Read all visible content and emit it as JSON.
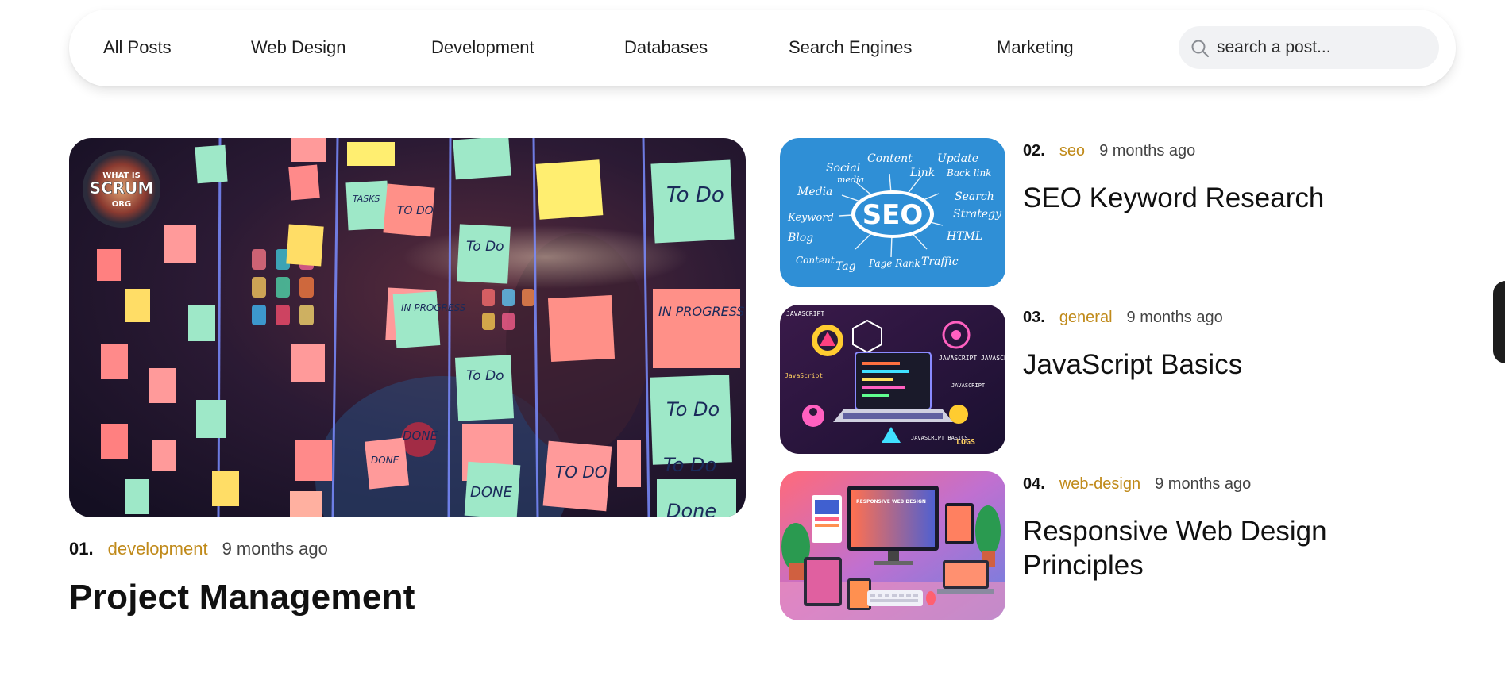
{
  "nav": {
    "links": [
      "All Posts",
      "Web Design",
      "Development",
      "Databases",
      "Search Engines",
      "Marketing"
    ],
    "divider": "|",
    "search": {
      "placeholder": "search a post...",
      "value": ""
    }
  },
  "featured": {
    "number": "01.",
    "category": "development",
    "time": "9 months ago",
    "title": "Project Management",
    "badge_text": [
      "WHAT IS",
      "SCRUM",
      "ORG"
    ],
    "notes": [
      "TASKS",
      "TO DO",
      "To Do",
      "IN PROGRESS",
      "To Do",
      "IN PROGRESS",
      "To Do",
      "DONE",
      "DONE",
      "TO DO",
      "DONE",
      "To Do",
      "To Do",
      "Done"
    ]
  },
  "posts": [
    {
      "number": "02.",
      "category": "seo",
      "time": "9 months ago",
      "title": "SEO Keyword Research",
      "image_words": [
        "SEO",
        "Social",
        "media",
        "Content",
        "Link",
        "Update",
        "Back link",
        "Search",
        "Strategy",
        "HTML",
        "Traffic",
        "Page Rank",
        "Tag",
        "Blog",
        "Keyword",
        "Media",
        "Content"
      ]
    },
    {
      "number": "03.",
      "category": "general",
      "time": "9 months ago",
      "title": "JavaScript Basics",
      "image_words": [
        "JAVASCRIPT",
        "JAVASCRIPT JAVASCPT",
        "JAVASCRIPT",
        "JavaScript",
        "JAVASCRIPT BASICS",
        "LOGS"
      ]
    },
    {
      "number": "04.",
      "category": "web-design",
      "time": "9 months ago",
      "title": "Responsive Web Design Principles",
      "image_words": [
        "RESPONSIVE WEB DESIGN"
      ]
    }
  ],
  "colors": {
    "category": "#c08a1a",
    "seo_bg": "#2f8fd6",
    "search_bg": "#f1f2f4"
  },
  "icons": {
    "search": "search-icon"
  }
}
